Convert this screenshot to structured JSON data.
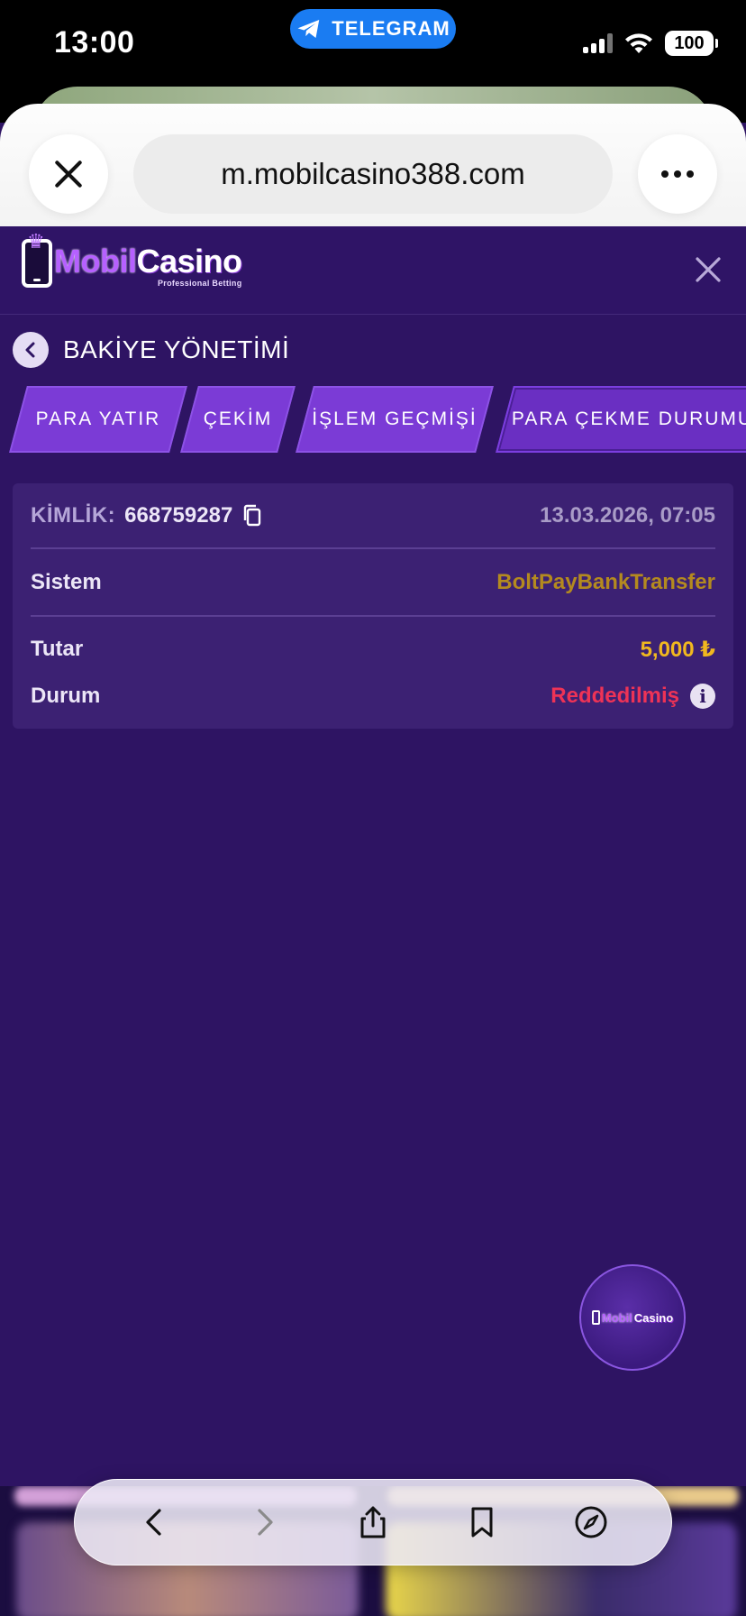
{
  "status_bar": {
    "time": "13:00",
    "telegram_label": "TELEGRAM",
    "battery": "100"
  },
  "browser": {
    "url": "m.mobilcasino388.com"
  },
  "site": {
    "logo_mobil": "Mobil",
    "logo_casino": "Casino",
    "logo_tagline": "Professional Betting"
  },
  "page": {
    "title": "BAKİYE YÖNETİMİ"
  },
  "tabs": [
    {
      "label": "PARA YATIR",
      "active": false
    },
    {
      "label": "ÇEKİM",
      "active": false
    },
    {
      "label": "İŞLEM GEÇMİŞİ",
      "active": false
    },
    {
      "label": "PARA ÇEKME DURUMU",
      "active": true
    }
  ],
  "withdrawal": {
    "id_label": "KİMLİK:",
    "id_value": "668759287",
    "date": "13.03.2026, 07:05",
    "system_label": "Sistem",
    "system_value": "BoltPayBankTransfer",
    "amount_label": "Tutar",
    "amount_value": "5,000 ₺",
    "status_label": "Durum",
    "status_value": "Reddedilmiş",
    "status_info_glyph": "i"
  },
  "float_button": {
    "logo_mobil": "Mobil",
    "logo_casino": "Casino"
  },
  "colors": {
    "page_bg": "#2e1463",
    "card_bg": "#3c2173",
    "tab_bg": "#7b3bd6",
    "system_value": "#b48a1f",
    "amount_value": "#f1b81f",
    "status_rejected": "#ee3356"
  },
  "icons": {
    "browser_close": "close-icon",
    "browser_more": "more-icon",
    "site_close": "close-icon",
    "back": "chevron-left-icon",
    "copy": "copy-icon",
    "info": "info-icon",
    "toolbar": [
      "back-arrow-icon",
      "forward-arrow-icon",
      "share-icon",
      "bookmarks-icon",
      "compass-icon"
    ]
  }
}
